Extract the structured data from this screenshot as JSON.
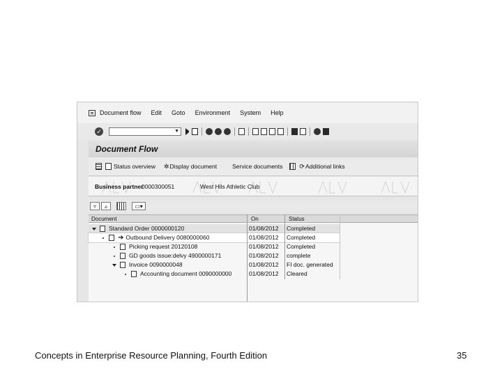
{
  "menu": [
    "Document flow",
    "Edit",
    "Goto",
    "Environment",
    "System",
    "Help"
  ],
  "window": {
    "title": "Document Flow"
  },
  "app_toolbar": {
    "status_overview": "Status overview",
    "display_document": "Display document",
    "service_documents": "Service documents",
    "additional_links": "Additional links"
  },
  "header": {
    "bp_label": "Business partner",
    "bp_number": "0000300051",
    "bp_name": "West Hils Athletic Club"
  },
  "grid": {
    "headers": {
      "document": "Document",
      "on": "On",
      "status": "Status"
    },
    "rows": [
      {
        "document": "Standard Order 0000000120",
        "on": "01/08/2012",
        "status": "Completed"
      },
      {
        "document": "Outbound Delivery 0080000060",
        "on": "01/08/2012",
        "status": "Completed"
      },
      {
        "document": "Picking request 20120108",
        "on": "01/08/2012",
        "status": "Completed"
      },
      {
        "document": "GD goods issue:delvy 4900000171",
        "on": "01/08/2012",
        "status": "complete"
      },
      {
        "document": "Invoice 0090000048",
        "on": "01/08/2012",
        "status": "FI doc. generated"
      },
      {
        "document": "Accounting document 0090000000",
        "on": "01/08/2012",
        "status": "Cleared"
      }
    ]
  },
  "footer": {
    "left": "Concepts in Enterprise Resource Planning, Fourth Edition",
    "page_number": "35"
  },
  "icons": {
    "menu": "sap-menu-icon",
    "enter": "enter-check-icon",
    "save": "save-icon",
    "back": "back-icon"
  }
}
